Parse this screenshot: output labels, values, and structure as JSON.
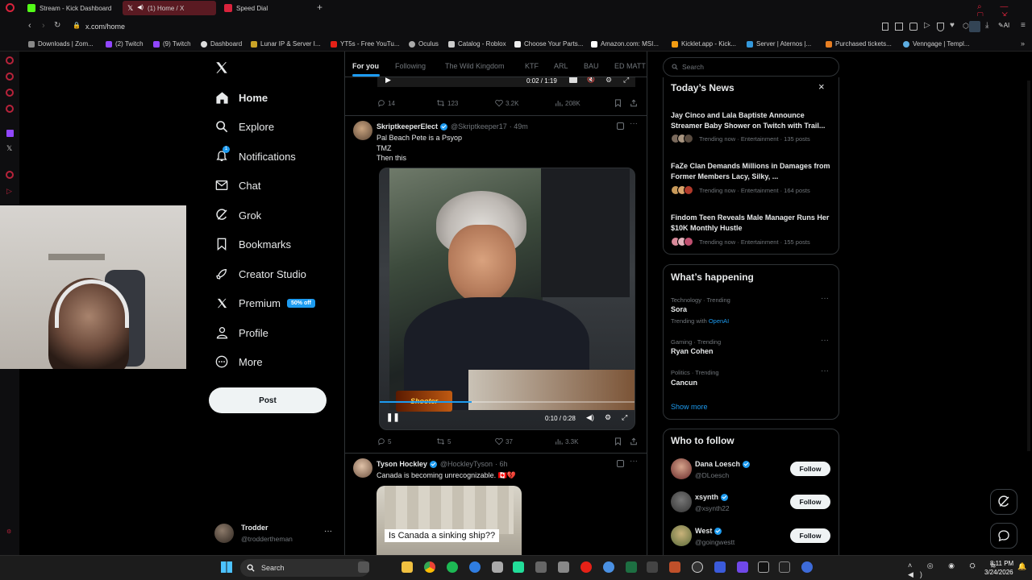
{
  "browser": {
    "tabs": [
      {
        "label": "Stream - Kick Dashboard",
        "color": "#53fc18"
      },
      {
        "label": "(1) Home / X",
        "color": "#ffffff"
      },
      {
        "label": "Speed Dial",
        "color": "#d9233c"
      }
    ],
    "new_tab": "+",
    "url": "x.com/home",
    "ai_label": "AI",
    "bookmarks": [
      "Downloads | Zom...",
      "(2) Twitch",
      "(9) Twitch",
      "Dashboard",
      "Lunar IP & Server I...",
      "YT5s - Free YouTu...",
      "Oculus",
      "Catalog - Roblox",
      "Choose Your Parts...",
      "Amazon.com: MSI...",
      "Kicklet.app - Kick...",
      "Server | Aternos |...",
      "Purchased tickets...",
      "Venngage | Templ..."
    ]
  },
  "nav": {
    "items": [
      {
        "label": "Home",
        "icon": "home-icon"
      },
      {
        "label": "Explore",
        "icon": "search-icon"
      },
      {
        "label": "Notifications",
        "icon": "bell-icon",
        "badge": "1"
      },
      {
        "label": "Chat",
        "icon": "mail-icon"
      },
      {
        "label": "Grok",
        "icon": "grok-icon"
      },
      {
        "label": "Bookmarks",
        "icon": "bookmark-icon"
      },
      {
        "label": "Creator Studio",
        "icon": "rocket-icon"
      },
      {
        "label": "Premium",
        "icon": "x-logo-icon",
        "badge": "50% off"
      },
      {
        "label": "Profile",
        "icon": "person-icon"
      },
      {
        "label": "More",
        "icon": "more-circle-icon"
      }
    ],
    "post_button": "Post",
    "account": {
      "name": "Trodder",
      "handle": "@troddertheman",
      "more": "···"
    }
  },
  "feed": {
    "tabs": [
      "For you",
      "Following",
      "The Wild Kingdom",
      "KTF",
      "ARL",
      "BAU",
      "ED MATT"
    ],
    "top_stats": {
      "replies": "14",
      "reposts": "123",
      "likes": "3.2K",
      "views": "208K",
      "video_time": "0:02 / 1:19"
    },
    "tweets": [
      {
        "name": "SkriptkeeperElect",
        "handle": "@Skriptkeeper17",
        "time": "· 49m",
        "lines": [
          "Pal Beach Pete is a Psyop",
          "TMZ",
          "Then this"
        ],
        "video_time": "0:10 / 0:28",
        "video_overlay": "Shooter",
        "replies": "5",
        "reposts": "5",
        "likes": "37",
        "views": "3.3K"
      },
      {
        "name": "Tyson Hockley",
        "handle": "@HockleyTyson",
        "time": "· 6h",
        "lines": [
          "Canada is becoming unrecognizable. 🇨🇦💔"
        ],
        "image_caption": "Is Canada a sinking ship??"
      }
    ]
  },
  "sidebar": {
    "search_placeholder": "Search",
    "news": {
      "title": "Today’s News",
      "close": "×",
      "items": [
        {
          "headline": "Jay Cinco and Lala Baptiste Announce Streamer Baby Shower on Twitch with Trail...",
          "meta": "Trending now · Entertainment · 135 posts"
        },
        {
          "headline": "FaZe Clan Demands Millions in Damages from Former Members Lacy, Silky, ...",
          "meta": "Trending now · Entertainment · 164 posts"
        },
        {
          "headline": "Findom Teen Reveals Male Manager Runs Her $10K Monthly Hustle",
          "meta": "Trending now · Entertainment · 155 posts"
        }
      ]
    },
    "happening": {
      "title": "What’s happening",
      "items": [
        {
          "category": "Technology · Trending",
          "name": "Sora",
          "extra_prefix": "Trending with ",
          "extra_link": "OpenAI"
        },
        {
          "category": "Gaming · Trending",
          "name": "Ryan Cohen"
        },
        {
          "category": "Politics · Trending",
          "name": "Cancun"
        }
      ],
      "show_more": "Show more"
    },
    "follow": {
      "title": "Who to follow",
      "button": "Follow",
      "users": [
        {
          "name": "Dana Loesch",
          "handle": "@DLoesch"
        },
        {
          "name": "xsynth",
          "handle": "@xsynth22"
        },
        {
          "name": "West",
          "handle": "@goingwestt"
        }
      ]
    }
  },
  "taskbar": {
    "search": "Search",
    "time": "8:11 PM",
    "date": "3/24/2026"
  },
  "colors": {
    "accent": "#1d9bf0",
    "background": "#000000",
    "text": "#e7e9ea",
    "muted": "#71767b",
    "border": "#2f3336"
  }
}
